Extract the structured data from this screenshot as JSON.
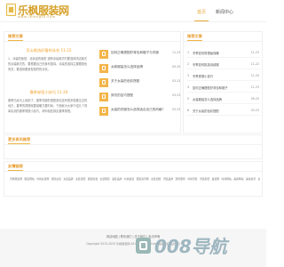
{
  "site": {
    "name": "乐枫服装网",
    "url_small": "www.lefengfu.com"
  },
  "nav": {
    "items": [
      {
        "label": "首页",
        "active": true
      },
      {
        "label": "新闻中心",
        "active": false
      }
    ]
  },
  "sections": {
    "recommended": {
      "title": "推荐文章",
      "articles": [
        {
          "title": "怎么挑选好看的泳衣",
          "date": "11-22",
          "body": "1、泳装的版型、化妆品的版型 选购泳装款式时要选择简洁款式的泳装款式的，要根据自己的身材选择。泳装的选择主要跟肤色有关，要选择跟身型相符的泳衣。"
        },
        {
          "title": "春季穿搭小技巧",
          "date": "11-20",
          "body": "春季已经马上就到了，春季衣服的搭配其实还有很多需要注意的地方，春季的穿搭既要保暖又要时尚，下面就为大家介绍几个简单实用的春季穿搭小技巧，帮你轻松搞定春季穿搭。"
        }
      ],
      "features": [
        {
          "title": "如何正确搭配好背包和帽子与衣服",
          "date": "11-23"
        },
        {
          "title": "女款服装怎么选择品牌",
          "date": "09-25"
        },
        {
          "title": "关于女装的色彩搭配",
          "date": "03-23"
        },
        {
          "title": "穿衣的技巧搭配",
          "date": "03-23"
        },
        {
          "title": "女装的衣服怎么选择适合自己的风格?",
          "date": "03-23"
        }
      ]
    },
    "sidebar": {
      "title": "推荐文章",
      "items": [
        {
          "num": "1",
          "title": "冬季如何穿搭最保暖",
          "date": "11-23"
        },
        {
          "num": "2",
          "title": "冬季如何挑选羽绒服",
          "date": "11-22"
        },
        {
          "num": "3",
          "title": "冬季穿搭小技巧",
          "date": "11-20"
        },
        {
          "num": "4",
          "title": "如何正确搭配好背包和帽子",
          "date": "11-23"
        },
        {
          "num": "5",
          "title": "女装服装怎么选择品牌",
          "date": "09-25"
        },
        {
          "num": "6",
          "title": "关于女装的色彩搭配",
          "date": "03-23"
        }
      ]
    },
    "more": {
      "title": "更多资讯推荐"
    },
    "friends": {
      "title": "友情链接",
      "links": [
        "乐枫服装网",
        "服装网站",
        "时尚女装网",
        "潮流女装",
        "女装品牌",
        "女装搭配",
        "服装批发",
        "女装网店",
        "童装品牌",
        "时尚童装",
        "服装资讯网",
        "女装加盟",
        "男装品牌",
        "潮男服饰",
        "时尚男装",
        "男装搭配",
        "童装网",
        "时尚网站",
        "美容网站",
        "美妆资讯",
        "女装网",
        "服装搭配",
        "女装潮流",
        "服装展示",
        "服装设计"
      ]
    }
  },
  "footer": {
    "links": "网站地图 | 联系我们 | 关于我们 | 免责声明",
    "copyright": "Copyright 2015-2020 乐枫服装网 All Rights Reserved 联系我们 站长QQ"
  },
  "watermark": {
    "text": "008导航"
  },
  "colors": {
    "accent": "#e79c2e",
    "footer_bg": "#f6f6f6",
    "watermark": "#9eb6bf"
  }
}
